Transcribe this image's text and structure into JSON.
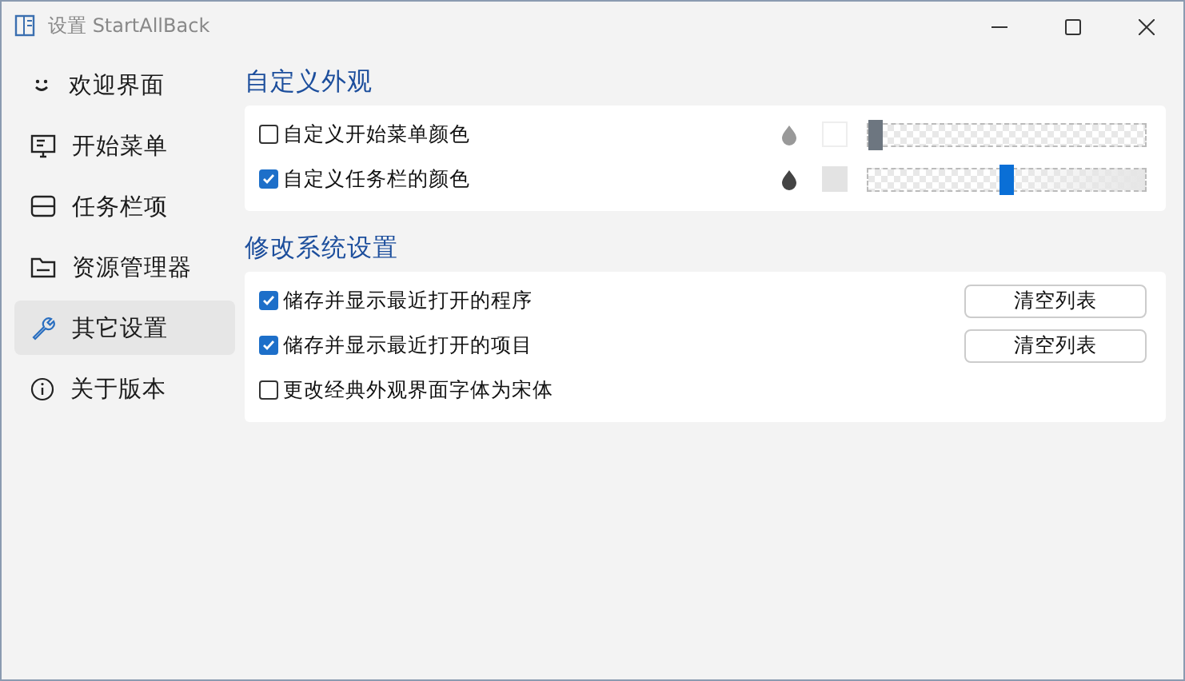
{
  "window": {
    "title": "设置 StartAllBack"
  },
  "sidebar": {
    "items": [
      {
        "label": "欢迎界面",
        "selected": false
      },
      {
        "label": "开始菜单",
        "selected": false
      },
      {
        "label": "任务栏项",
        "selected": false
      },
      {
        "label": "资源管理器",
        "selected": false
      },
      {
        "label": "其它设置",
        "selected": true
      },
      {
        "label": "关于版本",
        "selected": false
      }
    ]
  },
  "sections": [
    {
      "title": "自定义外观",
      "rows": [
        {
          "kind": "color",
          "label": "自定义开始菜单颜色",
          "checked": false,
          "level": 0
        },
        {
          "kind": "color",
          "label": "自定义任务栏的颜色",
          "checked": true,
          "level": 0.5
        }
      ]
    },
    {
      "title": "修改系统设置",
      "rows": [
        {
          "kind": "button",
          "label": "储存并显示最近打开的程序",
          "checked": true,
          "button": "清空列表"
        },
        {
          "kind": "button",
          "label": "储存并显示最近打开的项目",
          "checked": true,
          "button": "清空列表"
        },
        {
          "kind": "plain",
          "label": "更改经典外观界面字体为宋体",
          "checked": false
        }
      ]
    }
  ]
}
